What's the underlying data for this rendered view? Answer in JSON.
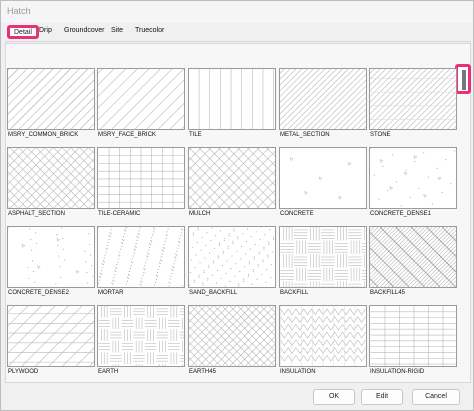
{
  "window": {
    "title": "Hatch"
  },
  "tabs": [
    {
      "label": "Detail"
    },
    {
      "label": "Drip"
    },
    {
      "label": "Groundcover"
    },
    {
      "label": "Site"
    },
    {
      "label": "Truecolor"
    }
  ],
  "hatches": [
    "MSRY_COMMON_BRICK",
    "MSRY_FACE_BRICK",
    "TILE",
    "METAL_SECTION",
    "STONE",
    "ASPHALT_SECTION",
    "TILE-CERAMIC",
    "MULCH",
    "CONCRETE",
    "CONCRETE_DENSE1",
    "CONCRETE_DENSE2",
    "MORTAR",
    "SAND_BACKFILL",
    "BACKFILL",
    "BACKFILL45",
    "PLYWOOD",
    "EARTH",
    "EARTH45",
    "INSULATION",
    "INSULATION-RIGID"
  ],
  "buttons": {
    "ok": "OK",
    "edit": "Edit",
    "cancel": "Cancel"
  }
}
